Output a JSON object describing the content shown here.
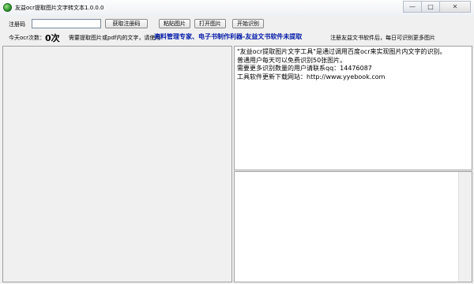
{
  "window": {
    "title": "友益ocr提取图片文字转文本1.0.0.0",
    "minimize_glyph": "—",
    "maximize_glyph": "□",
    "close_glyph": "✕"
  },
  "toolbar": {
    "reg_label": "注册码",
    "reg_value": "",
    "get_reg_btn": "获取注册码",
    "paste_btn": "粘贴图片",
    "open_btn": "打开图片",
    "start_btn": "开始识别"
  },
  "info": {
    "today_label": "今天ocr次数：",
    "today_count": "0次",
    "hint_text": "需要提取图片或pdf内的文字，请使用",
    "promo_text": "资料管理专家、电子书制作利器-友益文书软件未提取",
    "register_text": "注册友益文书软件后，每日可识别更多图片"
  },
  "output": {
    "lines": [
      "\"友益ocr提取图片文字工具\"是通过调用百度ocr来实现图片内文字的识别。",
      "普通用户每天可以免费识别50张图片。",
      "需要更多识别数量的用户请联系qq：14476087",
      "工具软件更新下载网站：http://www.yyebook.com"
    ]
  }
}
